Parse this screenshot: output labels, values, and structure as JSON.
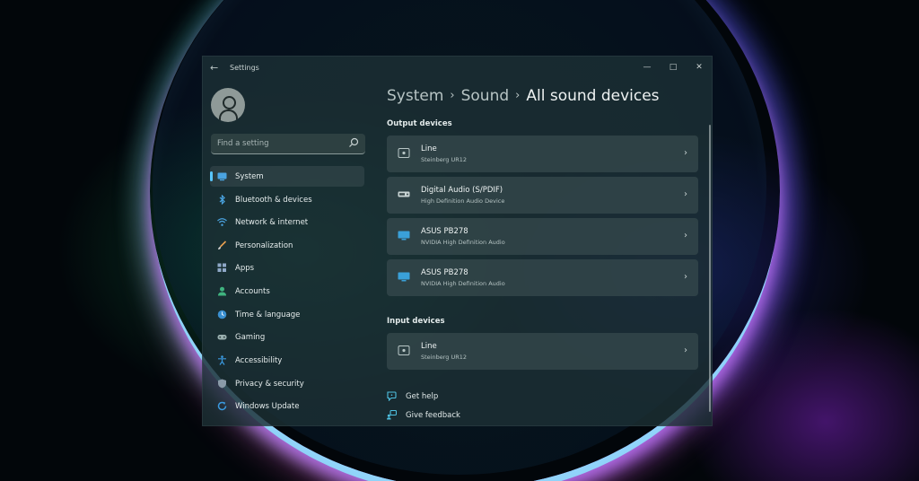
{
  "window": {
    "title": "Settings",
    "back_glyph": "←",
    "minimize_glyph": "—",
    "maximize_glyph": "□",
    "close_glyph": "✕"
  },
  "search": {
    "placeholder": "Find a setting"
  },
  "sidebar": {
    "items": [
      {
        "label": "System",
        "icon": "system-icon",
        "active": true
      },
      {
        "label": "Bluetooth & devices",
        "icon": "bluetooth-icon"
      },
      {
        "label": "Network & internet",
        "icon": "wifi-icon"
      },
      {
        "label": "Personalization",
        "icon": "brush-icon"
      },
      {
        "label": "Apps",
        "icon": "apps-icon"
      },
      {
        "label": "Accounts",
        "icon": "person-icon"
      },
      {
        "label": "Time & language",
        "icon": "globe-clock-icon"
      },
      {
        "label": "Gaming",
        "icon": "gamepad-icon"
      },
      {
        "label": "Accessibility",
        "icon": "accessibility-icon"
      },
      {
        "label": "Privacy & security",
        "icon": "shield-icon"
      },
      {
        "label": "Windows Update",
        "icon": "update-icon"
      }
    ]
  },
  "breadcrumb": {
    "items": [
      "System",
      "Sound",
      "All sound devices"
    ],
    "separator": "›"
  },
  "output_devices": {
    "title": "Output devices",
    "items": [
      {
        "name": "Line",
        "sub": "Steinberg UR12",
        "icon": "line-jack-icon"
      },
      {
        "name": "Digital Audio (S/PDIF)",
        "sub": "High Definition Audio Device",
        "icon": "spdif-device-icon"
      },
      {
        "name": "ASUS PB278",
        "sub": "NVIDIA High Definition Audio",
        "icon": "monitor-icon"
      },
      {
        "name": "ASUS PB278",
        "sub": "NVIDIA High Definition Audio",
        "icon": "monitor-icon"
      }
    ]
  },
  "input_devices": {
    "title": "Input devices",
    "items": [
      {
        "name": "Line",
        "sub": "Steinberg UR12",
        "icon": "line-jack-icon"
      }
    ]
  },
  "help": {
    "get_help": "Get help",
    "give_feedback": "Give feedback"
  },
  "chevron_glyph": "›",
  "colors": {
    "accent": "#58c6ff"
  }
}
